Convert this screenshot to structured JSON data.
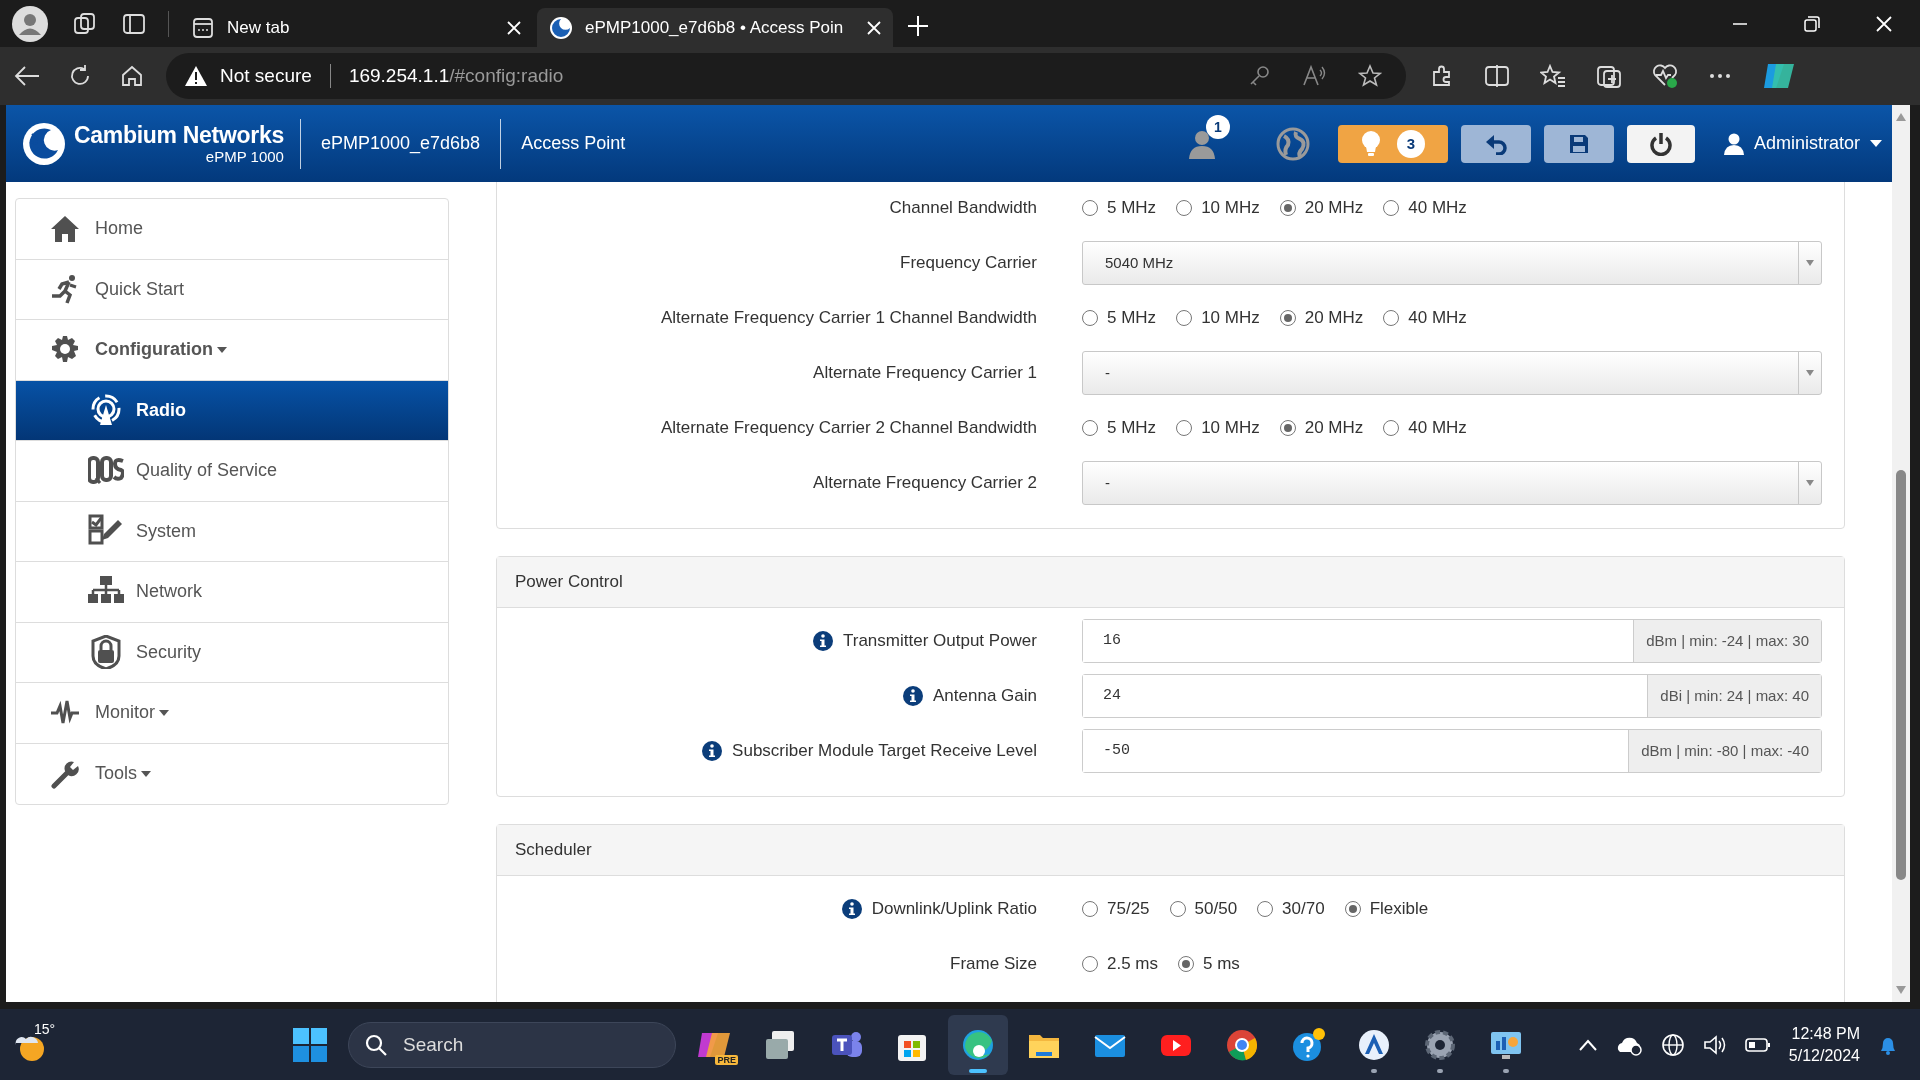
{
  "browser": {
    "tabs": [
      {
        "title": "New tab",
        "selected": false
      },
      {
        "title": "ePMP1000_e7d6b8 • Access Poin",
        "selected": true
      }
    ],
    "address": {
      "warning": "Not secure",
      "host": "169.254.1.1",
      "path": "/#config:radio"
    }
  },
  "header": {
    "brand": "Cambium Networks",
    "model": "ePMP 1000",
    "device": "ePMP1000_e7d6b8",
    "mode": "Access Point",
    "users_count": "1",
    "alerts_count": "3",
    "user": "Administrator"
  },
  "sidebar": {
    "items": [
      {
        "label": "Home",
        "kind": "link",
        "selected": false
      },
      {
        "label": "Quick Start",
        "kind": "link",
        "selected": false
      },
      {
        "label": "Configuration",
        "kind": "menu",
        "selected": false,
        "expanded": true,
        "children": [
          {
            "label": "Radio",
            "selected": true
          },
          {
            "label": "Quality of Service",
            "selected": false
          },
          {
            "label": "System",
            "selected": false
          },
          {
            "label": "Network",
            "selected": false
          },
          {
            "label": "Security",
            "selected": false
          }
        ]
      },
      {
        "label": "Monitor",
        "kind": "menu",
        "selected": false,
        "expanded": false
      },
      {
        "label": "Tools",
        "kind": "menu",
        "selected": false,
        "expanded": false
      }
    ]
  },
  "panels": [
    {
      "rows": [
        {
          "label": "Channel Bandwidth",
          "kind": "radio",
          "info": false,
          "options": [
            {
              "label": "5 MHz",
              "selected": false
            },
            {
              "label": "10 MHz",
              "selected": false
            },
            {
              "label": "20 MHz",
              "selected": true
            },
            {
              "label": "40 MHz",
              "selected": false
            }
          ]
        },
        {
          "label": "Frequency Carrier",
          "kind": "select",
          "info": false,
          "value": "5040 MHz"
        },
        {
          "label": "Alternate Frequency Carrier 1 Channel Bandwidth",
          "kind": "radio",
          "info": false,
          "options": [
            {
              "label": "5 MHz",
              "selected": false
            },
            {
              "label": "10 MHz",
              "selected": false
            },
            {
              "label": "20 MHz",
              "selected": true
            },
            {
              "label": "40 MHz",
              "selected": false
            }
          ]
        },
        {
          "label": "Alternate Frequency Carrier 1",
          "kind": "select",
          "info": false,
          "value": "-"
        },
        {
          "label": "Alternate Frequency Carrier 2 Channel Bandwidth",
          "kind": "radio",
          "info": false,
          "options": [
            {
              "label": "5 MHz",
              "selected": false
            },
            {
              "label": "10 MHz",
              "selected": false
            },
            {
              "label": "20 MHz",
              "selected": true
            },
            {
              "label": "40 MHz",
              "selected": false
            }
          ]
        },
        {
          "label": "Alternate Frequency Carrier 2",
          "kind": "select",
          "info": false,
          "value": "-"
        }
      ]
    },
    {
      "title": "Power Control",
      "rows": [
        {
          "label": "Transmitter Output Power",
          "kind": "input",
          "info": true,
          "value": "16",
          "unit": "dBm | min: -24 | max: 30"
        },
        {
          "label": "Antenna Gain",
          "kind": "input",
          "info": true,
          "value": "24",
          "unit": "dBi | min: 24 | max: 40"
        },
        {
          "label": "Subscriber Module Target Receive Level",
          "kind": "input",
          "info": true,
          "value": "-50",
          "unit": "dBm | min: -80 | max: -40"
        }
      ]
    },
    {
      "title": "Scheduler",
      "rows": [
        {
          "label": "Downlink/Uplink Ratio",
          "kind": "radio",
          "info": true,
          "options": [
            {
              "label": "75/25",
              "selected": false
            },
            {
              "label": "50/50",
              "selected": false
            },
            {
              "label": "30/70",
              "selected": false
            },
            {
              "label": "Flexible",
              "selected": true
            }
          ]
        },
        {
          "label": "Frame Size",
          "kind": "radio",
          "info": false,
          "options": [
            {
              "label": "2.5 ms",
              "selected": false
            },
            {
              "label": "5 ms",
              "selected": true
            }
          ]
        }
      ]
    }
  ],
  "taskbar": {
    "weather": "15°",
    "search": {
      "placeholder": "Search"
    },
    "apps": [
      {
        "badge": "PRE",
        "running": false,
        "active": false
      },
      {
        "running": false,
        "active": false
      },
      {
        "running": false,
        "active": false
      },
      {
        "running": false,
        "active": false
      },
      {
        "running": true,
        "active": true
      },
      {
        "running": false,
        "active": false
      },
      {
        "running": false,
        "active": false
      },
      {
        "running": false,
        "active": false
      },
      {
        "running": false,
        "active": false
      },
      {
        "running": false,
        "active": false
      },
      {
        "running": true,
        "active": false
      },
      {
        "running": true,
        "active": false
      },
      {
        "running": true,
        "active": false
      }
    ],
    "time": "12:48 PM",
    "date": "5/12/2024"
  }
}
